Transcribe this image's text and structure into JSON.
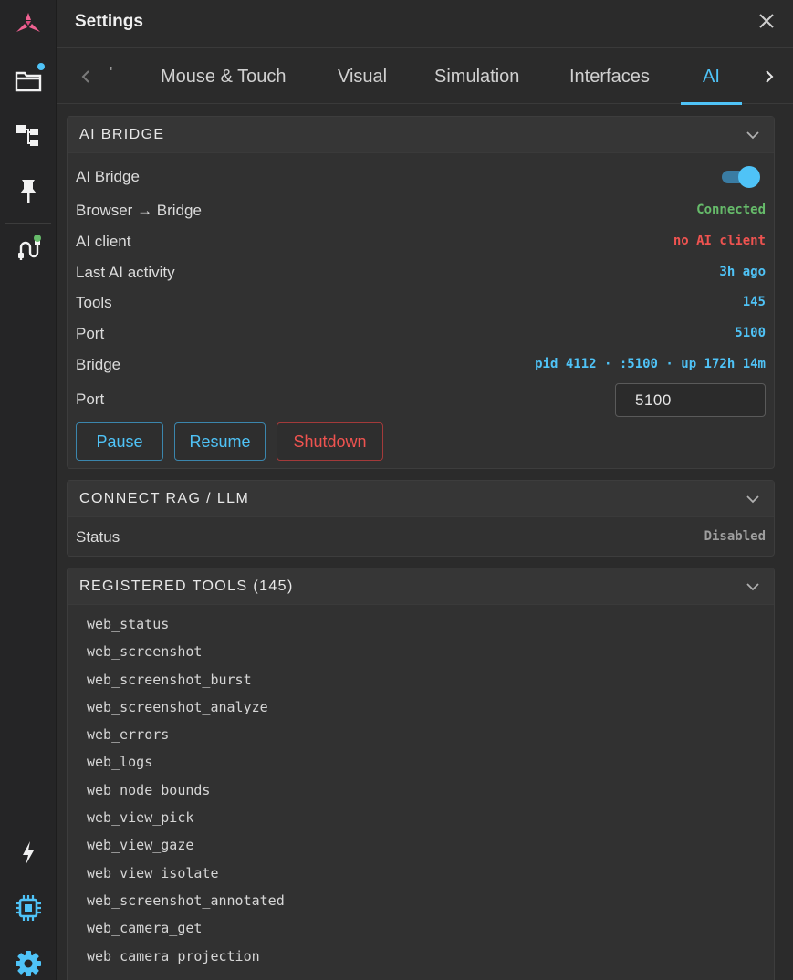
{
  "app": {
    "title": "Settings",
    "close_icon": "close-icon",
    "logo_icon": "app-logo-icon",
    "accent": "#4fc3f7",
    "logo_color": "#f06292"
  },
  "rail": {
    "items": [
      {
        "name": "folder-icon",
        "badge": "#4fc3f7"
      },
      {
        "name": "hierarchy-icon"
      },
      {
        "name": "pin-icon"
      },
      {
        "name": "cable-icon",
        "badge": "#66bb6a"
      },
      {
        "name": "lightning-icon"
      },
      {
        "name": "chip-icon"
      },
      {
        "name": "gear-icon"
      }
    ]
  },
  "tabs": {
    "fragment": "'",
    "items": [
      "Mouse & Touch",
      "Visual",
      "Simulation",
      "Interfaces",
      "AI"
    ],
    "active": "AI"
  },
  "ai_bridge": {
    "title": "AI BRIDGE",
    "toggle_label": "AI Bridge",
    "toggle_on": true,
    "rows": [
      {
        "label": "Browser → Bridge",
        "value": "Connected",
        "color": "#66bb6a"
      },
      {
        "label": "AI client",
        "value": "no AI client",
        "color": "#ef5350"
      },
      {
        "label": "Last AI activity",
        "value": "3h ago",
        "color": "#4fc3f7"
      },
      {
        "label": "Tools",
        "value": "145",
        "color": "#4fc3f7"
      },
      {
        "label": "Port",
        "value": "5100",
        "color": "#4fc3f7"
      },
      {
        "label": "Bridge",
        "value": "pid 4112 · :5100 · up 172h 14m",
        "color": "#4fc3f7"
      }
    ],
    "port_label": "Port",
    "port_value": "5100",
    "buttons": {
      "pause": "Pause",
      "resume": "Resume",
      "shutdown": "Shutdown"
    }
  },
  "rag": {
    "title": "CONNECT RAG / LLM",
    "status_label": "Status",
    "status_value": "Disabled",
    "status_color": "#9e9e9e"
  },
  "tools": {
    "title": "REGISTERED TOOLS (145)",
    "items": [
      "web_status",
      "web_screenshot",
      "web_screenshot_burst",
      "web_screenshot_analyze",
      "web_errors",
      "web_logs",
      "web_node_bounds",
      "web_view_pick",
      "web_view_gaze",
      "web_view_isolate",
      "web_screenshot_annotated",
      "web_camera_get",
      "web_camera_projection"
    ]
  }
}
